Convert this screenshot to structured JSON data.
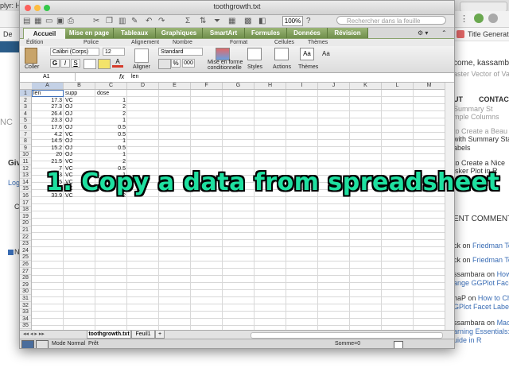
{
  "browser": {
    "tab_text": "plyr: How to Change the Ord",
    "bookmark_left": "De",
    "bookmark_right": "Title Generator ·"
  },
  "background_page": {
    "welcome": "come, kassambara",
    "faster_vector": "aster Vector of Va",
    "ut": "UT",
    "contact": "CONTAC",
    "summary_stat": "Summary St",
    "sample_columns": "mple Columns",
    "create_a_beau": "to Create a Beau",
    "with_summary": "with Summary Sta",
    "labels": "abels",
    "create_nice": "to Create a Nice",
    "whisker_plot": "isker Plot in R",
    "ent_comments": "ENT COMMENT",
    "comment1_author": "ck",
    "comment1_on": "on",
    "comment1_link": "Friedman Tes",
    "comment2_author": "ck",
    "comment2_on": "on",
    "comment2_link": "Friedman Tes",
    "comment3_author": "ssambara",
    "comment3_on": "on",
    "comment3_link": "How",
    "comment3_link2": "ange GGPlot Facet",
    "comment4_author": "haP",
    "comment4_on": "on",
    "comment4_link": "How to Cha",
    "comment4_link2": "GPlot Facet Labels",
    "comment5_author": "ssambara",
    "comment5_on": "on",
    "comment5_link": "Mach",
    "comment5_link2": "arning Essentials: P",
    "comment5_link3": "uide in R",
    "left_no": "NC",
    "left_giv": "Giv",
    "left_log": "Logi",
    "left_co": "Co",
    "left_checkbox": "No"
  },
  "excel": {
    "title": "toothgrowth.txt",
    "zoom": "100%",
    "search_placeholder": "Rechercher dans la feuille",
    "tabs": [
      "Accueil",
      "Mise en page",
      "Tableaux",
      "Graphiques",
      "SmartArt",
      "Formules",
      "Données",
      "Révision"
    ],
    "groups": [
      "Édition",
      "Police",
      "Alignement",
      "Nombre",
      "Format",
      "Cellules",
      "Thèmes"
    ],
    "ribbon": {
      "coller": "Coller",
      "font_name": "Calibri (Corps)",
      "font_size": "12",
      "bold": "G",
      "italic": "I",
      "underline": "S",
      "aligner": "Aligner",
      "number_format": "Standard",
      "percent": "%",
      "thousands": "000",
      "mise_en_forme": "Mise en forme",
      "conditionnelle": "conditionnelle",
      "styles": "Styles",
      "actions": "Actions",
      "themes": "Thèmes",
      "aa": "Aa"
    },
    "name_box": "A1",
    "fx": "fx",
    "formula_content": "len",
    "columns": [
      "A",
      "B",
      "C",
      "D",
      "E",
      "F",
      "G",
      "H",
      "I",
      "J",
      "K",
      "L",
      "M"
    ],
    "rows": [
      "1",
      "2",
      "3",
      "4",
      "5",
      "6",
      "7",
      "8",
      "9",
      "10",
      "11",
      "12",
      "13",
      "14",
      "15",
      "16",
      "17",
      "18",
      "19",
      "20",
      "21",
      "22",
      "23",
      "24",
      "25",
      "26",
      "27",
      "28",
      "29",
      "30",
      "31",
      "32",
      "33",
      "34",
      "35"
    ],
    "headers": [
      "len",
      "supp",
      "dose"
    ],
    "data": [
      [
        "17.3",
        "VC",
        "1"
      ],
      [
        "27.3",
        "OJ",
        "2"
      ],
      [
        "26.4",
        "OJ",
        "2"
      ],
      [
        "23.3",
        "OJ",
        "1"
      ],
      [
        "17.6",
        "OJ",
        "0.5"
      ],
      [
        "4.2",
        "VC",
        "0.5"
      ],
      [
        "14.5",
        "OJ",
        "1"
      ],
      [
        "15.2",
        "OJ",
        "0.5"
      ],
      [
        "20",
        "OJ",
        "1"
      ],
      [
        "21.5",
        "VC",
        "2"
      ],
      [
        "7",
        "VC",
        "0.5"
      ],
      [
        "13.3",
        "VC",
        "1"
      ],
      [
        "25.5",
        "VC",
        "2"
      ],
      [
        "25.5",
        "VC",
        "2"
      ],
      [
        "33.9",
        "VC",
        "2"
      ]
    ],
    "sheet_tabs": [
      "toothgrowth.txt",
      "Feuil1",
      "+"
    ],
    "status": {
      "mode": "Mode Normal",
      "ready": "Prêt",
      "sum": "Somme=0"
    }
  },
  "overlay_text": "1. Copy a data from spreadsheet"
}
